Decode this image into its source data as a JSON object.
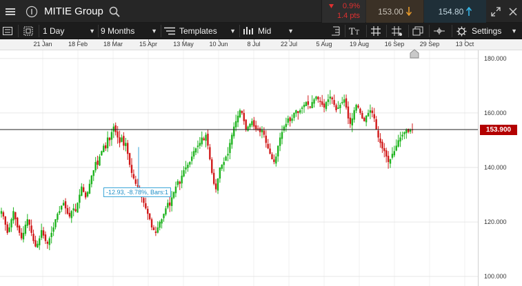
{
  "header": {
    "title": "MITIE Group",
    "change_pct": "0.9%",
    "change_pts": "1.4 pts",
    "sell_price": "153.00",
    "buy_price": "154.80"
  },
  "toolbar": {
    "interval": "1 Day",
    "period": "9 Months",
    "templates": "Templates",
    "price_type": "Mid",
    "settings": "Settings"
  },
  "chart_data": {
    "type": "candlestick",
    "x_tick_labels": [
      "21 Jan",
      "18 Feb",
      "18 Mar",
      "15 Apr",
      "13 May",
      "10 Jun",
      "8 Jul",
      "22 Jul",
      "5 Aug",
      "19 Aug",
      "16 Sep",
      "29 Sep",
      "13 Oct"
    ],
    "y_tick_labels": [
      "180.000",
      "160.000",
      "140.000",
      "120.000",
      "100.000"
    ],
    "y_ticks": [
      180,
      160,
      140,
      120,
      100
    ],
    "current_price": 153.9,
    "current_price_label": "153.900",
    "measurement_label": "-12.93, -8.78%, Bars:1",
    "up_color": "#1db31d",
    "down_color": "#d01818",
    "ylim": [
      96.5,
      183
    ],
    "closes": [
      124,
      122,
      119,
      116,
      118,
      121,
      124,
      121,
      118,
      116,
      114,
      116,
      119,
      121,
      119,
      116,
      113,
      111,
      112,
      114,
      117,
      115,
      113,
      112,
      114,
      116,
      118,
      121,
      123,
      124,
      126,
      127,
      125,
      123,
      122,
      124,
      125,
      124,
      127,
      130,
      133,
      131,
      129,
      131,
      134,
      137,
      139,
      142,
      141,
      144,
      146,
      148,
      147,
      151,
      150,
      153,
      155,
      153,
      151,
      149,
      151,
      148,
      149,
      145,
      141,
      138,
      136,
      134,
      133,
      131,
      129,
      127,
      125,
      123,
      121,
      118,
      117,
      116,
      118,
      120,
      121,
      123,
      125,
      127,
      126,
      129,
      131,
      133,
      135,
      134,
      137,
      139,
      140,
      141,
      142,
      144,
      146,
      147,
      148,
      149,
      151,
      150,
      152,
      148,
      143,
      138,
      134,
      132,
      136,
      140,
      141,
      142,
      144,
      145,
      149,
      152,
      155,
      157,
      159,
      161,
      160,
      157,
      154,
      155,
      156,
      157,
      155,
      154,
      154,
      153,
      154,
      152,
      149,
      147,
      145,
      143,
      142,
      144,
      148,
      151,
      153,
      155,
      156,
      158,
      157,
      158,
      160,
      161,
      160,
      161,
      162,
      163,
      164,
      163,
      162,
      164,
      165,
      166,
      165,
      164,
      163,
      162,
      164,
      165,
      166,
      165,
      163,
      161,
      162,
      163,
      164,
      165,
      162,
      158,
      156,
      158,
      161,
      163,
      162,
      160,
      158,
      157,
      159,
      160,
      161,
      160,
      158,
      154,
      151,
      149,
      147,
      146,
      144,
      142,
      143,
      145,
      146,
      148,
      150,
      151,
      152,
      153,
      154,
      153,
      154,
      153.9
    ]
  }
}
